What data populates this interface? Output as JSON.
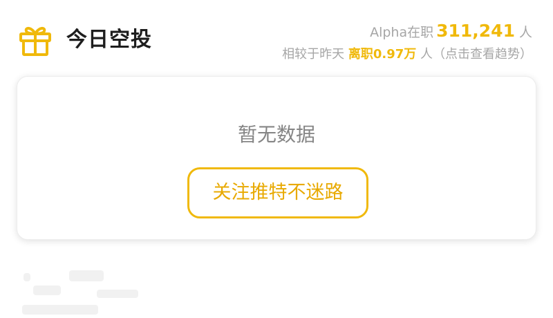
{
  "header": {
    "title": "今日空投",
    "gift_icon": "gift-icon",
    "accent_color": "#f0b90b"
  },
  "stats": {
    "employed_prefix": "Alpha在职",
    "employed_count": "311,241",
    "employed_unit": "人",
    "compare_prefix": "相较于昨天",
    "change_text": "离职0.97万",
    "compare_suffix": "人（点击查看趋势）"
  },
  "card": {
    "empty_text": "暂无数据",
    "follow_button_label": "关注推特不迷路"
  }
}
